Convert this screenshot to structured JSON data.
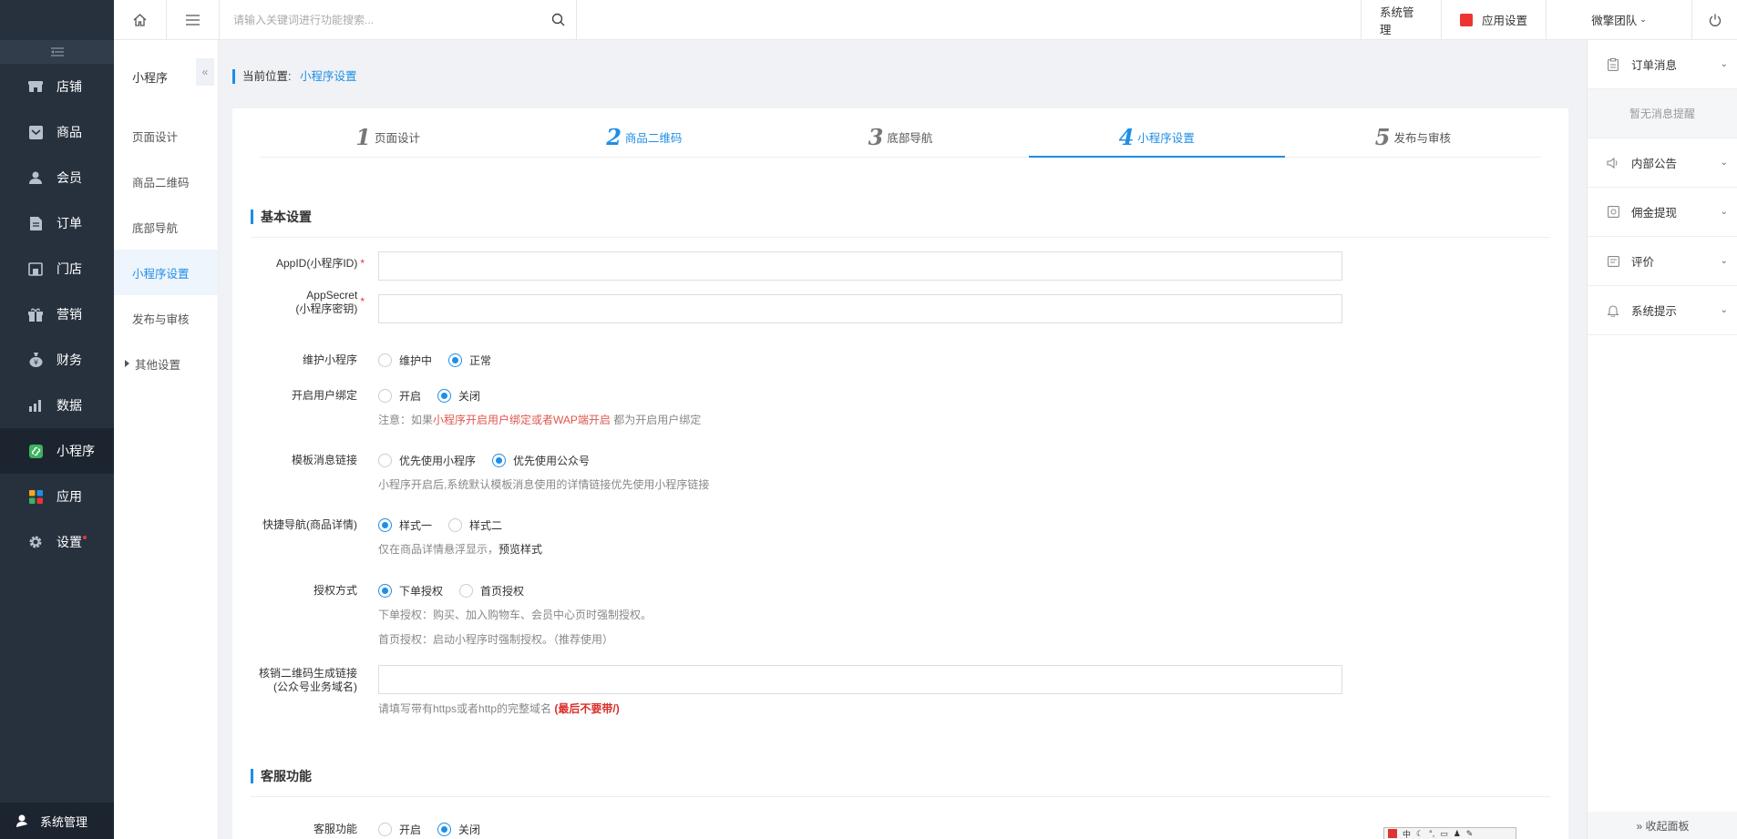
{
  "sidebar": {
    "items": [
      {
        "label": "店铺",
        "icon": "store-icon"
      },
      {
        "label": "商品",
        "icon": "product-icon"
      },
      {
        "label": "会员",
        "icon": "member-icon"
      },
      {
        "label": "订单",
        "icon": "order-icon"
      },
      {
        "label": "门店",
        "icon": "shop-icon"
      },
      {
        "label": "营销",
        "icon": "gift-icon"
      },
      {
        "label": "财务",
        "icon": "money-bag-icon"
      },
      {
        "label": "数据",
        "icon": "chart-icon"
      },
      {
        "label": "小程序",
        "icon": "miniprogram-icon"
      },
      {
        "label": "应用",
        "icon": "apps-icon"
      },
      {
        "label": "设置",
        "icon": "gear-icon"
      }
    ],
    "active_index": 8,
    "bottom_label": "系统管理"
  },
  "subnav": {
    "title": "小程序",
    "fold_glyph": "«",
    "items": [
      "页面设计",
      "商品二维码",
      "底部导航",
      "小程序设置",
      "发布与审核",
      "其他设置"
    ],
    "active_index": 3
  },
  "topbar": {
    "search_placeholder": "请输入关键词进行功能搜索...",
    "system_label": "系统管理",
    "app_settings_label": "应用设置",
    "team_label": "微擎团队"
  },
  "breadcrumb": {
    "prefix": "当前位置:",
    "current": "小程序设置"
  },
  "steps": [
    {
      "num": "1",
      "label": "页面设计"
    },
    {
      "num": "2",
      "label": "商品二维码"
    },
    {
      "num": "3",
      "label": "底部导航"
    },
    {
      "num": "4",
      "label": "小程序设置"
    },
    {
      "num": "5",
      "label": "发布与审核"
    }
  ],
  "form": {
    "section_basic": "基本设置",
    "appid_label": "AppID(小程序ID)",
    "appsecret_label_1": "AppSecret",
    "appsecret_label_2": "(小程序密钥)",
    "maintain_label": "维护小程序",
    "maintain_options": [
      "维护中",
      "正常"
    ],
    "maintain_selected": "正常",
    "bind_label": "开启用户绑定",
    "bind_options": [
      "开启",
      "关闭"
    ],
    "bind_selected": "关闭",
    "bind_hint_prefix": "注意：如果",
    "bind_hint_red": "小程序开启用户绑定或者WAP端开启",
    "bind_hint_suffix": " 都为开启用户绑定",
    "template_label": "模板消息链接",
    "template_options": [
      "优先使用小程序",
      "优先使用公众号"
    ],
    "template_selected": "优先使用公众号",
    "template_hint": "小程序开启后,系统默认模板消息使用的详情链接优先使用小程序链接",
    "quicknav_label": "快捷导航(商品详情)",
    "quicknav_options": [
      "样式一",
      "样式二"
    ],
    "quicknav_selected": "样式一",
    "quicknav_hint": "仅在商品详情悬浮显示，",
    "quicknav_hint_link": "预览样式",
    "auth_label": "授权方式",
    "auth_options": [
      "下单授权",
      "首页授权"
    ],
    "auth_selected": "下单授权",
    "auth_hint_1": "下单授权：购买、加入购物车、会员中心页时强制授权。",
    "auth_hint_2": "首页授权：启动小程序时强制授权。（推荐使用）",
    "verify_label_1": "核销二维码生成链接",
    "verify_label_2": "(公众号业务域名)",
    "verify_hint": "请填写带有https或者http的完整域名 ",
    "verify_hint_red": "(最后不要带/)",
    "section_service": "客服功能",
    "service_label": "客服功能",
    "service_options": [
      "开启",
      "关闭"
    ],
    "service_selected": "关闭"
  },
  "rpanel": {
    "items": [
      {
        "label": "订单消息",
        "icon": "clipboard-icon"
      },
      {
        "label": "内部公告",
        "icon": "speaker-icon"
      },
      {
        "label": "佣金提现",
        "icon": "wallet-icon"
      },
      {
        "label": "评价",
        "icon": "comment-icon"
      },
      {
        "label": "系统提示",
        "icon": "bell-icon"
      }
    ],
    "empty_text": "暂无消息提醒",
    "collapse_label": "» 收起面板"
  },
  "ime": {
    "glyphs": "中"
  },
  "colors": {
    "accent": "#1f8ee6",
    "sidebar_bg": "#27313e",
    "danger": "#e33333"
  }
}
